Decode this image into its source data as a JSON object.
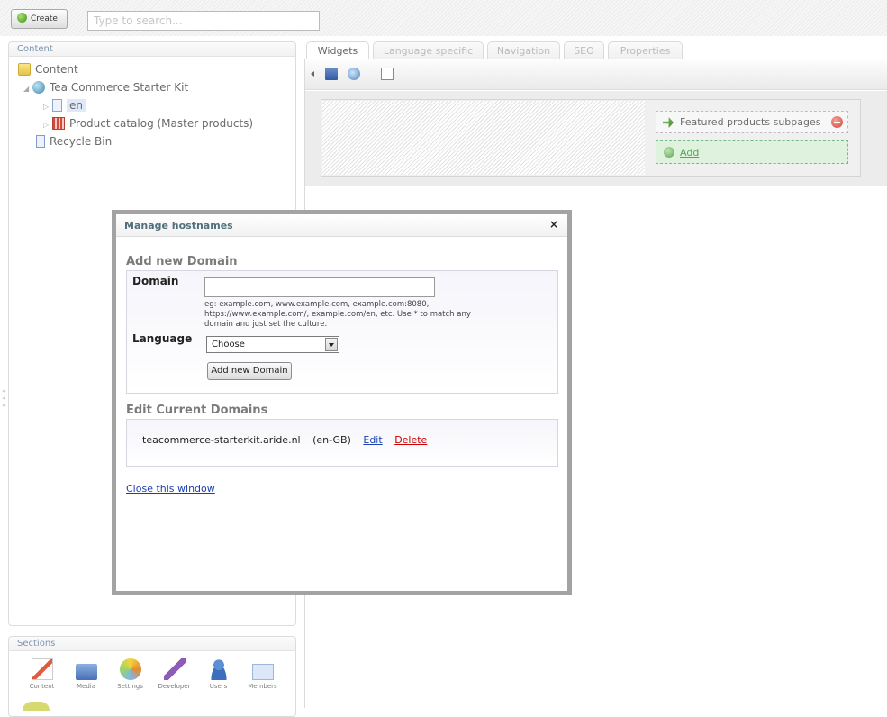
{
  "topbar": {
    "create_label": "Create",
    "search_placeholder": "Type to search..."
  },
  "content_panel": {
    "title": "Content",
    "tree": {
      "root": "Content",
      "site": "Tea Commerce Starter Kit",
      "en": "en",
      "catalog": "Product catalog (Master products)",
      "recycle": "Recycle Bin"
    }
  },
  "sections_panel": {
    "title": "Sections",
    "items": [
      "Content",
      "Media",
      "Settings",
      "Developer",
      "Users",
      "Members"
    ]
  },
  "tabs": [
    "Widgets",
    "Language specific",
    "Navigation",
    "SEO",
    "Properties"
  ],
  "widgets": {
    "item_label": "Featured products subpages",
    "add_label": "Add"
  },
  "modal": {
    "title": "Manage hostnames",
    "close_glyph": "×",
    "add_heading": "Add new Domain",
    "domain_label": "Domain",
    "domain_value": "",
    "hint": "eg: example.com, www.example.com, example.com:8080, https://www.example.com/, example.com/en, etc. Use * to match any domain and just set the culture.",
    "language_label": "Language",
    "language_selected": "Choose",
    "add_button": "Add new Domain",
    "edit_heading": "Edit Current Domains",
    "current_domain": {
      "host": "teacommerce-starterkit.aride.nl",
      "culture": "(en-GB)",
      "edit": "Edit",
      "delete": "Delete"
    },
    "close_link": "Close this window"
  }
}
